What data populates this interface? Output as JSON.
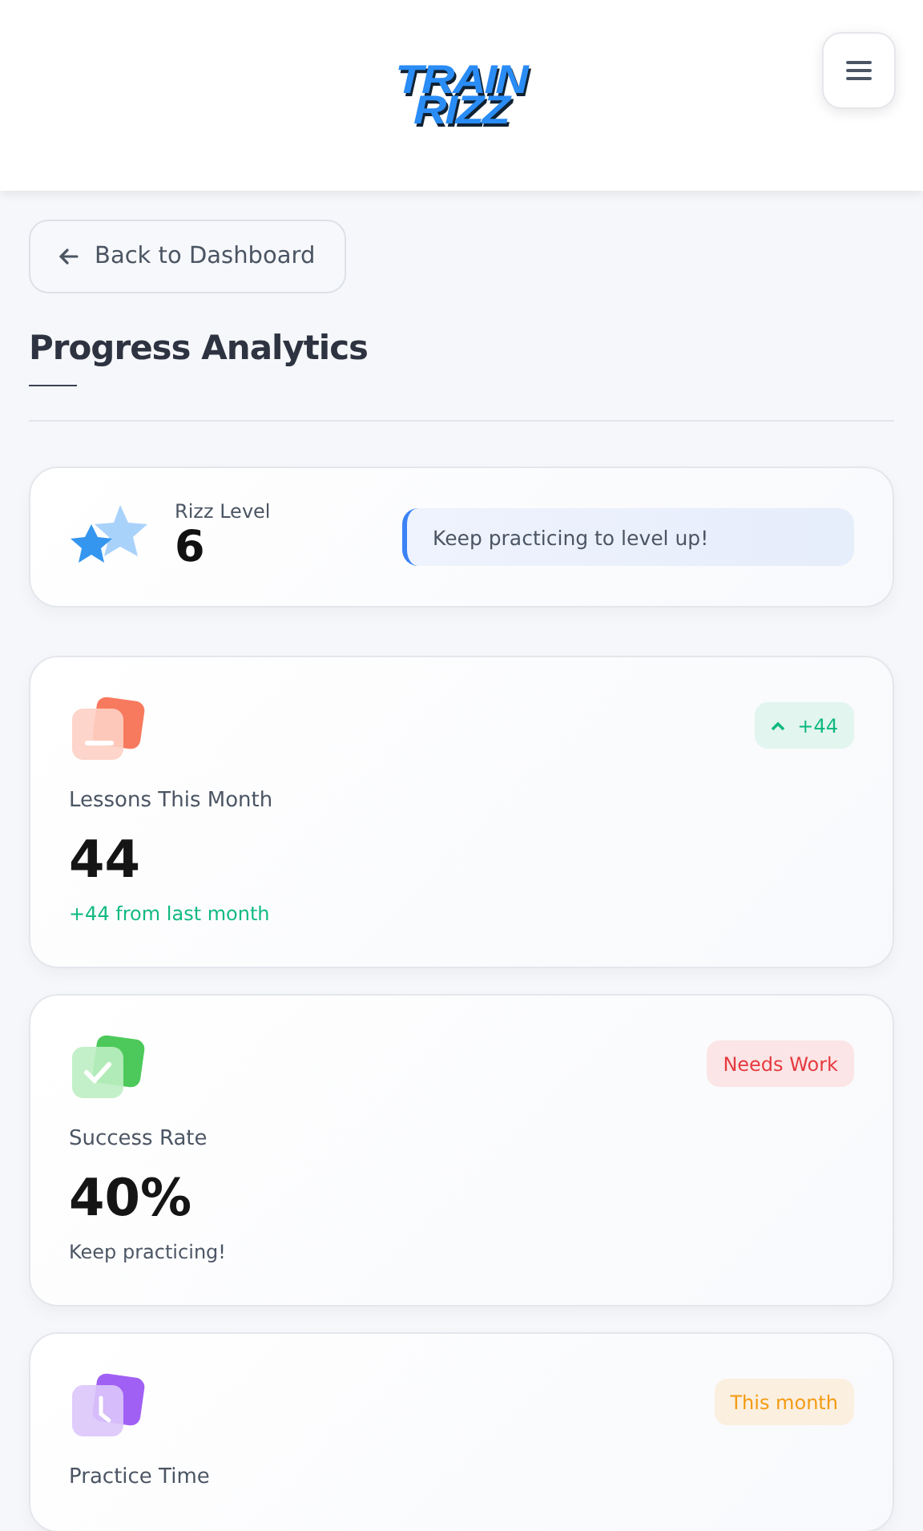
{
  "header": {
    "logo_lines": [
      "TRAIN",
      "RIZZ"
    ]
  },
  "back_button": {
    "label": "Back to Dashboard"
  },
  "title": "Progress Analytics",
  "level_card": {
    "label": "Rizz Level",
    "value": "6",
    "message": "Keep practicing to level up!"
  },
  "stats": [
    {
      "kind": "lessons",
      "badge": {
        "kind": "up",
        "text": "+44"
      },
      "label": "Lessons This Month",
      "value": "44",
      "note": {
        "kind": "positive",
        "text": "+44 from last month"
      }
    },
    {
      "kind": "success",
      "badge": {
        "kind": "danger",
        "text": "Needs Work"
      },
      "label": "Success Rate",
      "value": "40%",
      "note": {
        "kind": "neutral",
        "text": "Keep practicing!"
      }
    },
    {
      "kind": "time",
      "badge": {
        "kind": "warning",
        "text": "This month"
      },
      "label": "Practice Time"
    }
  ]
}
